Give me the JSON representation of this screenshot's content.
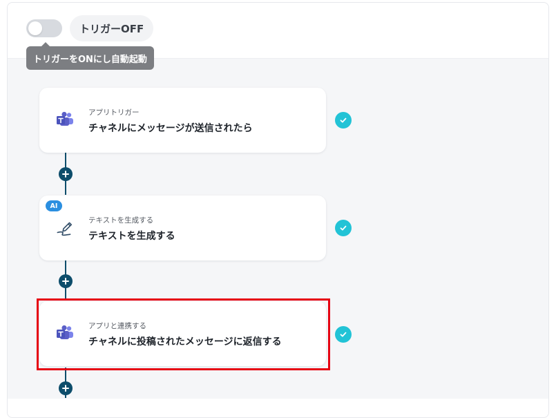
{
  "header": {
    "toggle_state": "off",
    "trigger_status_label": "トリガーOFF",
    "tooltip_text": "トリガーをONにし自動起動"
  },
  "flow": {
    "steps": [
      {
        "subtitle": "アプリトリガー",
        "title": "チャネルにメッセージが送信されたら",
        "icon": "microsoft-teams-icon",
        "status": "completed",
        "badge": ""
      },
      {
        "subtitle": "テキストを生成する",
        "title": "テキストを生成する",
        "icon": "pen-scribble-icon",
        "status": "completed",
        "badge": "AI"
      },
      {
        "subtitle": "アプリと連携する",
        "title": "チャネルに投稿されたメッセージに返信する",
        "icon": "microsoft-teams-icon",
        "status": "completed",
        "badge": "",
        "highlighted": true
      }
    ]
  },
  "colors": {
    "connector": "#0d4d6b",
    "check": "#22c3d6",
    "ai_badge": "#2b8fe0",
    "highlight": "#e60012",
    "teams_purple": "#5b5fc7"
  }
}
